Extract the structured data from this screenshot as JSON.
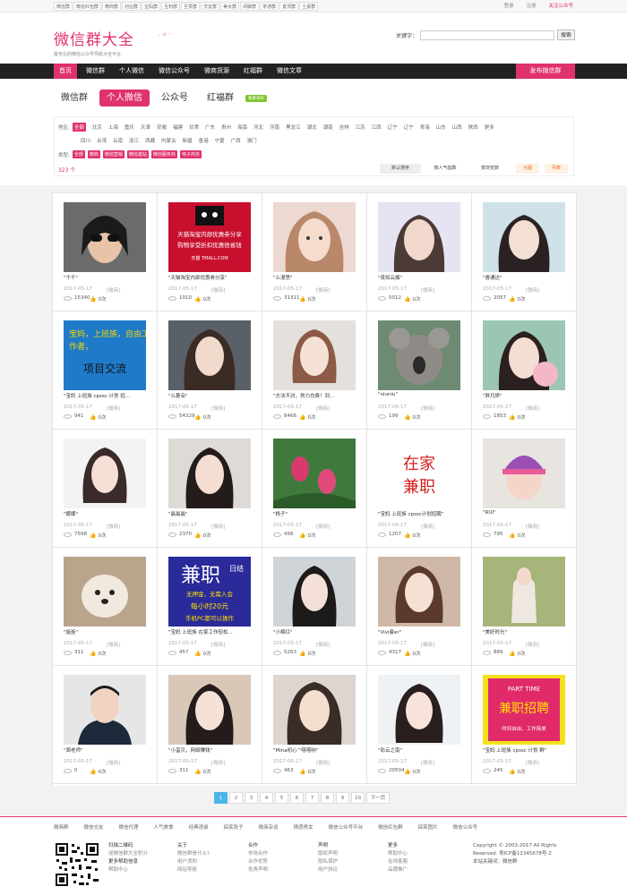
{
  "top_tags": [
    "微信群",
    "微信红包群",
    "微商群",
    "创业群",
    "宝妈群",
    "互粉群",
    "互赞群",
    "交友群",
    "美女群",
    "闲聊群",
    "茶游群",
    "置顶群",
    "土豪群"
  ],
  "top_links": {
    "login": "登录",
    "register": "注册",
    "follow": "关注公众号"
  },
  "logo": {
    "title": "微信群大全",
    "subtitle": "最专业的微信公众号导航大全平台"
  },
  "search": {
    "label": "关键字：",
    "placeholder": "",
    "button": "搜索"
  },
  "nav": {
    "items": [
      "首页",
      "微信群",
      "个人微信",
      "微信公众号",
      "微商货源",
      "红福群",
      "微信文章"
    ],
    "publish": "发布微信群"
  },
  "categories": {
    "items": [
      "微信群",
      "个人微信",
      "公众号",
      "红福群"
    ],
    "badge": "我要发布"
  },
  "filter": {
    "region_label": "地区:",
    "regions_row1": [
      "全部",
      "北京",
      "上海",
      "重庆",
      "天津",
      "安徽",
      "福建",
      "甘肃",
      "广东",
      "贵州",
      "海南",
      "河北",
      "河南",
      "黑龙江",
      "湖北",
      "湖南",
      "吉林",
      "江苏",
      "江西",
      "辽宁",
      "辽宁",
      "青海",
      "山东",
      "山西",
      "陕西",
      "更多"
    ],
    "regions_row2": [
      "四川",
      "台湾",
      "云南",
      "浙江",
      "西藏",
      "内蒙古",
      "新疆",
      "香港",
      "宁夏",
      "广西",
      "澳门"
    ],
    "type_label": "类型:",
    "types": [
      "全部",
      "微商",
      "微信营销",
      "微信建站",
      "微信服务商",
      "电子商务"
    ],
    "count": "323 个",
    "sorts": [
      "默认排序",
      "按人气指数",
      "按浏览数"
    ],
    "views": [
      "大图",
      "列表"
    ]
  },
  "cards": [
    {
      "name": "\"千千\"",
      "date": "2017-05-17",
      "cat": "[微商]",
      "views": "15340",
      "likes": "0次"
    },
    {
      "name": "\"天猫淘宝内部优惠券分享\"",
      "date": "2017-05-17",
      "cat": "[微商]",
      "views": "1010",
      "likes": "0次"
    },
    {
      "name": "\"么漫思\"",
      "date": "2017-05-17",
      "cat": "[微商]",
      "views": "31311",
      "likes": "0次"
    },
    {
      "name": "\"夜如云烟\"",
      "date": "2017-05-17",
      "cat": "[微商]",
      "views": "5012",
      "likes": "0次"
    },
    {
      "name": "\"睿通达\"",
      "date": "2017-05-17",
      "cat": "[微商]",
      "views": "2057",
      "likes": "0次"
    },
    {
      "name": "\"宝妈 上班族 cpssc 计划 招...",
      "date": "2017-05-17",
      "cat": "[微商]",
      "views": "941",
      "likes": "0次"
    },
    {
      "name": "\"么菱朵\"",
      "date": "2017-05-17",
      "cat": "[微商]",
      "views": "54329",
      "likes": "0次"
    },
    {
      "name": "\"方法不对，努力白费！到...",
      "date": "2017-05-17",
      "cat": "[微商]",
      "views": "8466",
      "likes": "0次"
    },
    {
      "name": "\"niuniu\"",
      "date": "2017-05-17",
      "cat": "[微商]",
      "views": "199",
      "likes": "0次"
    },
    {
      "name": "\"胖月妍\"",
      "date": "2017-05-17",
      "cat": "[微商]",
      "views": "1853",
      "likes": "0次"
    },
    {
      "name": "\"娜娜\"",
      "date": "2017-05-17",
      "cat": "[微商]",
      "views": "7598",
      "likes": "0次"
    },
    {
      "name": "\"晨晨晨\"",
      "date": "2017-05-17",
      "cat": "[微商]",
      "views": "2370",
      "likes": "0次"
    },
    {
      "name": "\"桃子\"",
      "date": "2017-05-17",
      "cat": "[微商]",
      "views": "456",
      "likes": "0次"
    },
    {
      "name": "\"宝妈 上班族 cpssc计划招聘\"",
      "date": "2017-05-17",
      "cat": "[微商]",
      "views": "1207",
      "likes": "0次"
    },
    {
      "name": "\"RUI\"",
      "date": "2017-05-17",
      "cat": "[微商]",
      "views": "795",
      "likes": "0次"
    },
    {
      "name": "\"旋旋\"",
      "date": "2017-05-17",
      "cat": "[微商]",
      "views": "311",
      "likes": "0次"
    },
    {
      "name": "\"宝妈 上班族 在家工作轻松...",
      "date": "2017-05-17",
      "cat": "[微商]",
      "views": "457",
      "likes": "0次"
    },
    {
      "name": "\"小棉红\"",
      "date": "2017-05-17",
      "cat": "[微商]",
      "views": "5263",
      "likes": "0次"
    },
    {
      "name": "\"Vivi曼er\"",
      "date": "2017-05-17",
      "cat": "[微商]",
      "views": "4317",
      "likes": "0次"
    },
    {
      "name": "\"美好时光\"",
      "date": "2017-05-17",
      "cat": "[微商]",
      "views": "889",
      "likes": "0次"
    },
    {
      "name": "\"周老师\"",
      "date": "2017-05-17",
      "cat": "[微商]",
      "views": "0",
      "likes": "0次"
    },
    {
      "name": "\"小蛮贝，网络赚钱\"",
      "date": "2017-05-17",
      "cat": "[微商]",
      "views": "311",
      "likes": "0次"
    },
    {
      "name": "\"Mina初心^嘻嘻呐\"",
      "date": "2017-05-17",
      "cat": "[微商]",
      "views": "463",
      "likes": "0次"
    },
    {
      "name": "\"彩云之南\"",
      "date": "2017-05-17",
      "cat": "[微商]",
      "views": "20504",
      "likes": "0次"
    },
    {
      "name": "\"宝妈 上班族 cpssc 计划 群\"",
      "date": "2017-05-17",
      "cat": "[微商]",
      "views": "245",
      "likes": "0次"
    }
  ],
  "thumb_text": {
    "c2": [
      "天猫淘宝内部优惠券分享",
      "购物享受折扣优惠很省钱",
      "天猫 TMALL.COM"
    ],
    "c6": [
      "宝妈，上班族，自由工",
      "作者，",
      "项目交流"
    ],
    "c14": [
      "在家",
      "兼职"
    ],
    "c17": [
      "兼职",
      "日结",
      "无押金，无需入会",
      "每小时20元",
      "手机PC都可以操作"
    ],
    "c25": [
      "PART TIME",
      "兼职招聘",
      "时间自由，工作简单"
    ]
  },
  "pager": {
    "pages": [
      "1",
      "2",
      "3",
      "4",
      "5",
      "6",
      "7",
      "8",
      "9",
      "10"
    ],
    "next": "下一页"
  },
  "footer": {
    "links": [
      "微商群",
      "微信交友",
      "微信代理",
      "人气美食",
      "经典语录",
      "搞笑段子",
      "微商杂谈",
      "情感男女",
      "微信公众号平台",
      "微信红包群",
      "搞笑图片",
      "微信公众号"
    ],
    "qr_col": {
      "h1": "扫描二维码",
      "l1": "送微信群大全积分",
      "h2": "更多帮助信息",
      "l2": "帮助中心"
    },
    "about": {
      "h": "关于",
      "l": [
        "微信群是什么?",
        "用户须知",
        "网站导航"
      ]
    },
    "coop": {
      "h": "合作",
      "l": [
        "市场合作",
        "合作优势",
        "免责声明"
      ]
    },
    "statement": {
      "h": "声明",
      "l": [
        "版权声明",
        "隐私保护",
        "用户协议"
      ]
    },
    "more": {
      "h": "更多",
      "l": [
        "帮助中心",
        "在线客服",
        "品牌推广"
      ]
    },
    "copyright": [
      "Copyright © 2003-2017 All Rights",
      "Reserved.  粤ICP备12345678号-2",
      "本站关键词：微信群"
    ]
  }
}
